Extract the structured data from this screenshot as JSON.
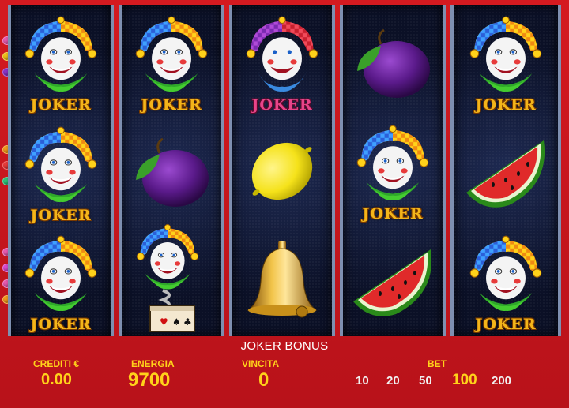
{
  "reels": [
    [
      "joker",
      "joker",
      "joker"
    ],
    [
      "joker",
      "plum",
      "jack-in-the-box"
    ],
    [
      "joker-pink",
      "lemon",
      "bell"
    ],
    [
      "plum",
      "joker",
      "watermelon"
    ],
    [
      "joker",
      "watermelon",
      "joker"
    ]
  ],
  "symbol_text": {
    "joker": "JOKER"
  },
  "panel": {
    "bonus_title": "JOKER BONUS",
    "credits_label": "CREDITI €",
    "credits_value": "0.00",
    "energy_label": "ENERGIA",
    "energy_value": "9700",
    "win_label": "VINCITA",
    "win_value": "0",
    "bet_label": "BET",
    "bet_options": [
      "10",
      "20",
      "50",
      "100",
      "200"
    ],
    "bet_selected": "100"
  },
  "colors": {
    "frame": "#c8161c",
    "label_yellow": "#ffd21a",
    "reel_border": "#7e8fb0"
  },
  "side_indicators": [
    "pink",
    "yellow",
    "purple",
    "orange",
    "red",
    "green",
    "pink",
    "pink",
    "pink",
    "orange"
  ]
}
